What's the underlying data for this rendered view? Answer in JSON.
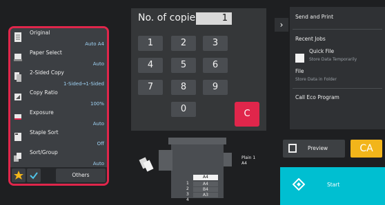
{
  "settings": {
    "items": [
      {
        "label": "Original",
        "value": "Auto A4"
      },
      {
        "label": "Paper Select",
        "value": "Auto"
      },
      {
        "label": "2-Sided Copy",
        "value": "1-Sided→1-Sided"
      },
      {
        "label": "Copy Ratio",
        "value": "100%"
      },
      {
        "label": "Exposure",
        "value": "Auto"
      },
      {
        "label": "Staple Sort",
        "value": "Off"
      },
      {
        "label": "Sort/Group",
        "value": "Auto"
      }
    ],
    "others_label": "Others"
  },
  "copies": {
    "label": "No. of copies",
    "value": "1"
  },
  "keypad": {
    "keys": [
      "1",
      "2",
      "3",
      "4",
      "5",
      "6",
      "7",
      "8",
      "9",
      "0"
    ],
    "clear_label": "C"
  },
  "right_menu": {
    "send_and_print": "Send and Print",
    "recent_jobs": "Recent Jobs",
    "quick_file": "Quick File",
    "quick_file_sub": "Store Data Temporarily",
    "file": "File",
    "file_sub": "Store Data in Folder",
    "call_eco": "Call Eco Program"
  },
  "machine": {
    "tray_plain": "Plain 1",
    "tray_size": "A4",
    "trays": [
      "A4",
      "A4",
      "B4",
      "A3"
    ],
    "tray_numbers": [
      "1",
      "2",
      "3",
      "4"
    ]
  },
  "actions": {
    "preview_label": "Preview",
    "ca_label": "CA",
    "start_label": "Start"
  },
  "colors": {
    "accent_red": "#e0264b",
    "ca_yellow": "#f2b51a",
    "start_cyan": "#00bfd1",
    "value_blue": "#9fd3f5"
  }
}
